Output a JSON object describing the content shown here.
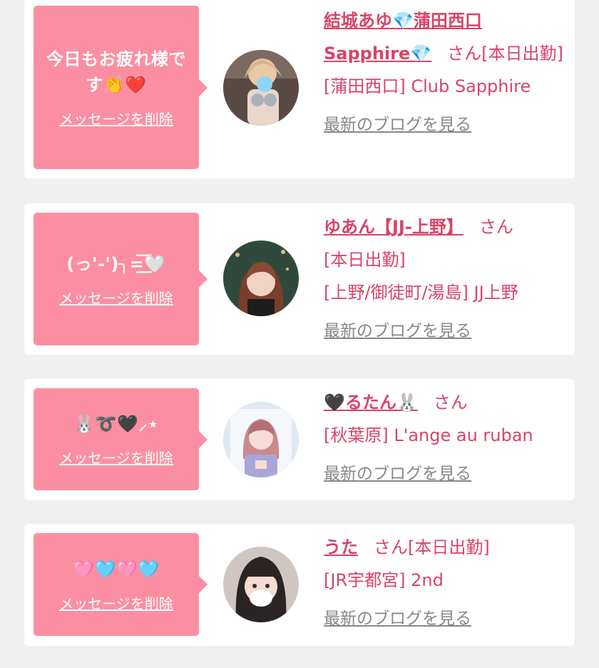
{
  "cards": [
    {
      "message": "今日もお疲れ様です👏❤️",
      "delete_label": "メッセージを削除",
      "name": "結城あゆ💎蒲田西口Sapphire💎",
      "honorific": "さん",
      "status": "[本日出勤]",
      "shop": "[蒲田西口] Club Sapphire",
      "blog_label": "最新のブログを見る"
    },
    {
      "message": "(っ'-')╮=͟͟͞͞🤍",
      "delete_label": "メッセージを削除",
      "name": "ゆあん【JJ-上野】",
      "honorific": "さん",
      "status": "[本日出勤]",
      "shop": "[上野/御徒町/湯島] JJ上野",
      "blog_label": "最新のブログを見る"
    },
    {
      "message": "🐰➰🖤⸝⋆",
      "delete_label": "メッセージを削除",
      "name": "🖤るたん🐰",
      "honorific": "さん",
      "status": "",
      "shop": "[秋葉原] L'ange au ruban",
      "blog_label": "最新のブログを見る"
    },
    {
      "message": "🩷🩵🩷🩵",
      "delete_label": "メッセージを削除",
      "name": "うた",
      "honorific": "さん",
      "status": "[本日出勤]",
      "shop": "[JR宇都宮] 2nd",
      "blog_label": "最新のブログを見る"
    }
  ],
  "colors": {
    "bubble": "#fb8fa1",
    "accent_text": "#d94468",
    "link_gray": "#888888",
    "background": "#f0f0f0"
  }
}
